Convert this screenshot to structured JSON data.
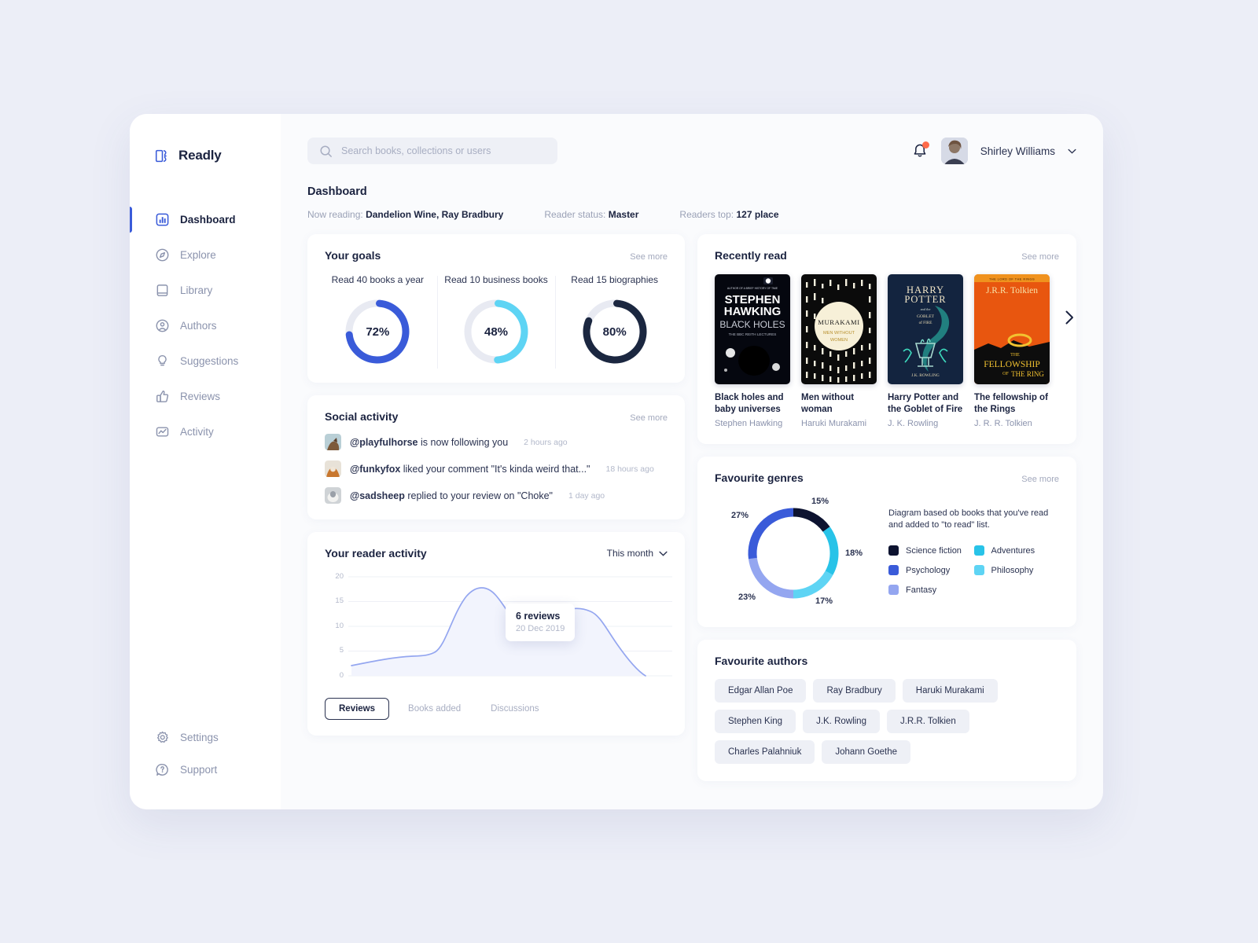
{
  "brand": {
    "name": "Readly",
    "logo_icon": "book-b-logo-icon",
    "accent": "#3a5bd9"
  },
  "sidebar": {
    "items": [
      {
        "label": "Dashboard",
        "icon": "bar-chart-icon",
        "active": true
      },
      {
        "label": "Explore",
        "icon": "compass-icon",
        "active": false
      },
      {
        "label": "Library",
        "icon": "book-icon",
        "active": false
      },
      {
        "label": "Authors",
        "icon": "user-circle-icon",
        "active": false
      },
      {
        "label": "Suggestions",
        "icon": "lightbulb-icon",
        "active": false
      },
      {
        "label": "Reviews",
        "icon": "thumbs-up-icon",
        "active": false
      },
      {
        "label": "Activity",
        "icon": "activity-graph-icon",
        "active": false
      }
    ],
    "bottom_items": [
      {
        "label": "Settings",
        "icon": "gear-icon"
      },
      {
        "label": "Support",
        "icon": "question-bubble-icon"
      }
    ]
  },
  "topbar": {
    "search_placeholder": "Search books, collections or users",
    "search_value": "",
    "search_icon": "search-icon",
    "bell_icon": "bell-icon",
    "has_notification": true,
    "user_name": "Shirley Williams",
    "chevron_icon": "chevron-down-icon"
  },
  "page": {
    "title": "Dashboard",
    "meta": [
      {
        "label": "Now reading:",
        "value": "Dandelion Wine, Ray Bradbury"
      },
      {
        "label": "Reader status:",
        "value": "Master"
      },
      {
        "label": "Readers top:",
        "value": "127 place"
      }
    ]
  },
  "goals": {
    "title": "Your goals",
    "see_more": "See more",
    "items": [
      {
        "label": "Read 40 books a year",
        "value": "72%",
        "percent": 72,
        "color": "#3a5bd9"
      },
      {
        "label": "Read 10 business books",
        "value": "48%",
        "percent": 48,
        "color": "#5ed4f4"
      },
      {
        "label": "Read 15 biographies",
        "value": "80%",
        "percent": 80,
        "color": "#1b2740"
      }
    ]
  },
  "social": {
    "title": "Social activity",
    "see_more": "See more",
    "items": [
      {
        "user": "@playfulhorse",
        "text": " is now following you",
        "time": "2 hours ago",
        "avatar_color": "#7d5a3a"
      },
      {
        "user": "@funkyfox",
        "text": " liked your comment \"It's kinda weird that...\"",
        "time": "18 hours ago",
        "avatar_color": "#c8772e"
      },
      {
        "user": "@sadsheep",
        "text": " replied to your review on \"Choke\"",
        "time": "1 day ago",
        "avatar_color": "#9aa0a8"
      }
    ]
  },
  "reader_activity": {
    "title": "Your reader activity",
    "period": "This month",
    "period_icon": "chevron-down-icon",
    "tooltip": {
      "main": "6 reviews",
      "sub": "20 Dec 2019"
    },
    "tabs": [
      {
        "label": "Reviews",
        "active": true
      },
      {
        "label": "Books added",
        "active": false
      },
      {
        "label": "Discussions",
        "active": false
      }
    ]
  },
  "recently_read": {
    "title": "Recently read",
    "see_more": "See more",
    "next_icon": "chevron-right-icon",
    "books": [
      {
        "title": "Black holes and baby universes",
        "author": "Stephen Hawking",
        "cover": {
          "style": "hawking",
          "line1": "AUTHOR OF A BRIEF HISTORY OF TIME",
          "line2": "STEPHEN",
          "line3": "HAWKING",
          "line4": "BLACK HOLES",
          "line5": "THE BBC REITH LECTURES"
        }
      },
      {
        "title": "Men without woman",
        "author": "Haruki Murakami",
        "cover": {
          "style": "murakami",
          "line1": "MURAKAMI",
          "line2": "MEN WITHOUT",
          "line3": "WOMEN"
        }
      },
      {
        "title": "Harry Potter and the Goblet of Fire",
        "author": "J. K. Rowling",
        "cover": {
          "style": "potter",
          "line1": "HARRY",
          "line2": "POTTER",
          "line3": "and the",
          "line4": "GOBLET",
          "line5": "of FIRE",
          "line6": "J.K. ROWLING"
        }
      },
      {
        "title": "The fellowship of the Rings",
        "author": "J. R. R. Tolkien",
        "cover": {
          "style": "lotr",
          "line1": "THE LORD OF THE RINGS",
          "line2": "J.R.R. Tolkien",
          "line3": "THE",
          "line4": "FELLOWSHIP",
          "line5": "OF",
          "line6": "THE RING"
        }
      }
    ]
  },
  "genres": {
    "title": "Favourite genres",
    "see_more": "See more",
    "description": "Diagram based ob books that you've read and added to \"to read\" list.",
    "legend": [
      {
        "label": "Science fiction",
        "color": "#0d1330"
      },
      {
        "label": "Adventures",
        "color": "#28c3e8"
      },
      {
        "label": "Psychology",
        "color": "#3a5bd9"
      },
      {
        "label": "Philosophy",
        "color": "#5ed4f4"
      },
      {
        "label": "Fantasy",
        "color": "#94a6f0"
      }
    ]
  },
  "authors": {
    "title": "Favourite authors",
    "items": [
      "Edgar Allan Poe",
      "Ray Bradbury",
      "Haruki Murakami",
      "Stephen King",
      "J.K. Rowling",
      "J.R.R. Tolkien",
      "Charles Palahniuk",
      "Johann Goethe"
    ]
  },
  "chart_data": [
    {
      "type": "area",
      "title": "Your reader activity",
      "xlabel": "",
      "ylabel": "",
      "ylim": [
        0,
        20
      ],
      "yticks": [
        0,
        5,
        10,
        15,
        20
      ],
      "grid": true,
      "legend_position": "none",
      "series": [
        {
          "name": "Reviews",
          "color": "#94a6f0",
          "values": [
            2,
            3.4,
            4.2,
            4.3,
            4.4,
            10,
            18,
            17.2,
            12,
            10,
            10.6,
            12.4,
            13.1,
            12,
            7,
            2
          ]
        }
      ],
      "annotations": [
        {
          "label": "6 reviews",
          "sublabel": "20 Dec 2019",
          "x_index": 9,
          "y": 10
        }
      ]
    },
    {
      "type": "pie",
      "title": "Favourite genres",
      "labels": [
        "Science fiction",
        "Adventures",
        "Philosophy",
        "Fantasy",
        "Psychology"
      ],
      "values": [
        15,
        18,
        17,
        23,
        27
      ],
      "value_labels": [
        "15%",
        "18%",
        "17%",
        "23%",
        "27%"
      ],
      "colors": [
        "#0d1330",
        "#28c3e8",
        "#5ed4f4",
        "#94a6f0",
        "#3a5bd9"
      ],
      "legend_position": "right",
      "donut": true
    },
    {
      "type": "pie",
      "title": "Read 40 books a year",
      "labels": [
        "Complete",
        "Remaining"
      ],
      "values": [
        72,
        28
      ],
      "value_labels": [
        "72%",
        ""
      ],
      "colors": [
        "#3a5bd9",
        "#e8eaf2"
      ],
      "donut": true,
      "legend_position": "none"
    },
    {
      "type": "pie",
      "title": "Read 10 business books",
      "labels": [
        "Complete",
        "Remaining"
      ],
      "values": [
        48,
        52
      ],
      "value_labels": [
        "48%",
        ""
      ],
      "colors": [
        "#5ed4f4",
        "#e8eaf2"
      ],
      "donut": true,
      "legend_position": "none"
    },
    {
      "type": "pie",
      "title": "Read 15 biographies",
      "labels": [
        "Complete",
        "Remaining"
      ],
      "values": [
        80,
        20
      ],
      "value_labels": [
        "80%",
        ""
      ],
      "colors": [
        "#1b2740",
        "#e8eaf2"
      ],
      "donut": true,
      "legend_position": "none"
    }
  ]
}
